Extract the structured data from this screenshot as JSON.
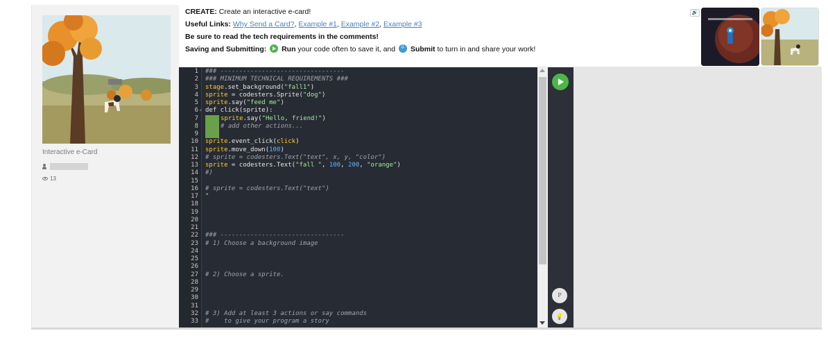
{
  "sidebar": {
    "card_title": "Interactive e-Card",
    "views": "13"
  },
  "header": {
    "create_label": "CREATE:",
    "create_text": " Create an interactive e-card!",
    "links_label": "Useful Links:",
    "links": [
      "Why Send a Card?",
      "Example #1",
      "Example #2",
      "Example #3"
    ],
    "tech_note": "Be sure to read the tech requirements in the comments!",
    "saving_label": "Saving and Submitting:",
    "run_label": "Run",
    "run_text": " your code often to save it, and ",
    "submit_label": "Submit",
    "submit_text": " to turn in and share your work!",
    "sound_icon": "speaker-icon"
  },
  "editor": {
    "lines": [
      {
        "n": "1",
        "html": "<span class='cmt'>### ---------------------------------</span>"
      },
      {
        "n": "2",
        "html": "<span class='cmt'>### MINIMUM TECHNICAL REQUIREMENTS ###</span>"
      },
      {
        "n": "3",
        "html": "<span class='kw'>stage</span>.set_background(<span class='str'>\"fall1\"</span>)"
      },
      {
        "n": "4",
        "html": "<span class='kw'>sprite</span> = codesters.Sprite(<span class='str'>\"dog\"</span>)"
      },
      {
        "n": "5",
        "html": "<span class='kw'>sprite</span>.say(<span class='str'>\"feed me\"</span>)"
      },
      {
        "n": "6",
        "html": "def click(sprite):",
        "fold": true
      },
      {
        "n": "7",
        "html": "<span class='indent'></span><span class='kw'>sprite</span>.say(<span class='str'>\"Hello, friend!\"</span>)"
      },
      {
        "n": "8",
        "html": "<span class='indent'></span><span class='cmt'># add other actions...</span>"
      },
      {
        "n": "9",
        "html": "<span class='indent'></span>"
      },
      {
        "n": "10",
        "html": "<span class='kw'>sprite</span>.event_click(<span class='kw'>click</span>)"
      },
      {
        "n": "11",
        "html": "<span class='kw'>sprite</span>.move_down(<span class='num'>100</span>)"
      },
      {
        "n": "12",
        "html": "<span class='cmt'># sprite = codesters.Text(\"text\", x, y, \"color\")</span>"
      },
      {
        "n": "13",
        "html": "<span class='kw'>sprite</span> = codesters.Text(<span class='str'>\"fall \"</span>, <span class='num'>100</span>, <span class='num'>200</span>, <span class='str'>\"orange\"</span>)"
      },
      {
        "n": "14",
        "html": "<span class='cmt'>#)</span>"
      },
      {
        "n": "15",
        "html": ""
      },
      {
        "n": "16",
        "html": "<span class='cmt'># sprite = codesters.Text(\"text\")</span>"
      },
      {
        "n": "17",
        "html": "<span class='str'>\"</span>"
      },
      {
        "n": "18",
        "html": ""
      },
      {
        "n": "19",
        "html": ""
      },
      {
        "n": "20",
        "html": ""
      },
      {
        "n": "21",
        "html": ""
      },
      {
        "n": "22",
        "html": "<span class='cmt'>### ---------------------------------</span>"
      },
      {
        "n": "23",
        "html": "<span class='cmt'># 1) Choose a background image</span>"
      },
      {
        "n": "24",
        "html": ""
      },
      {
        "n": "25",
        "html": ""
      },
      {
        "n": "26",
        "html": ""
      },
      {
        "n": "27",
        "html": "<span class='cmt'># 2) Choose a sprite.</span>"
      },
      {
        "n": "28",
        "html": ""
      },
      {
        "n": "29",
        "html": ""
      },
      {
        "n": "30",
        "html": ""
      },
      {
        "n": "31",
        "html": ""
      },
      {
        "n": "32",
        "html": "<span class='cmt'># 3) Add at least 3 actions or say commands</span>"
      },
      {
        "n": "33",
        "html": "<span class='cmt'>#    to give your program a story</span>"
      }
    ]
  },
  "toolbar": {
    "p_label": "P",
    "hint_label": "💡"
  },
  "colors": {
    "run_green": "#4cb648",
    "submit_blue": "#3a9ad9",
    "editor_bg": "#272b33",
    "link_blue": "#4a7fc1"
  }
}
